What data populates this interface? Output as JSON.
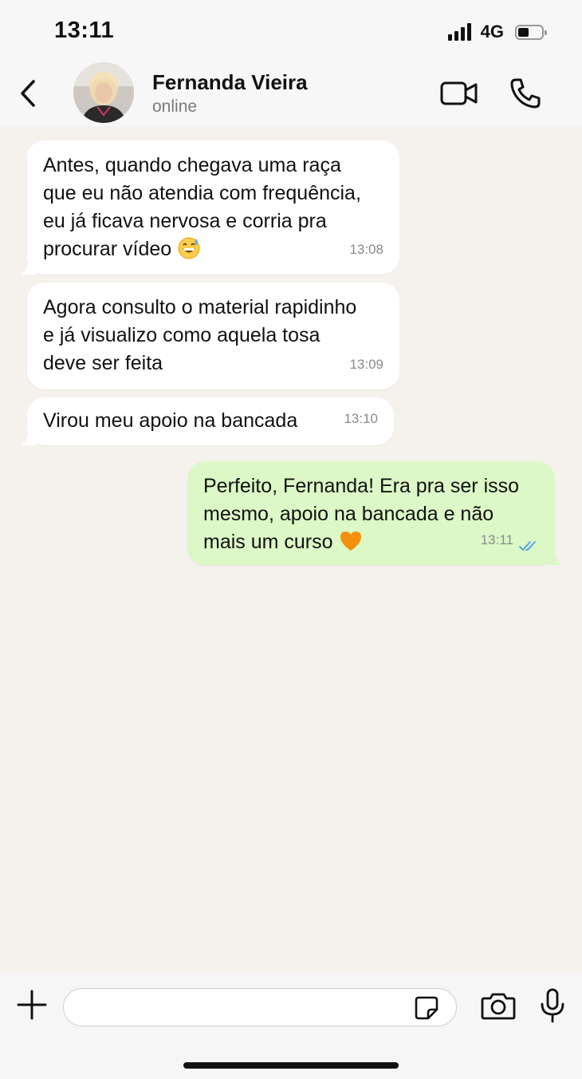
{
  "status_bar": {
    "time": "13:11",
    "network": "4G",
    "signal_bars": 4,
    "battery_level": 0.45
  },
  "header": {
    "contact_name": "Fernanda Vieira",
    "contact_status": "online",
    "back_icon": "chevron-left-icon",
    "video_icon": "video-camera-icon",
    "phone_icon": "phone-icon"
  },
  "messages": [
    {
      "direction": "incoming",
      "text": "Antes, quando chegava uma raça\nque eu não atendia com frequência,\neu já ficava nervosa e corria pra\nprocurar vídeo",
      "emoji": "grinning-sweat-face",
      "time": "13:08"
    },
    {
      "direction": "incoming",
      "text": "Agora consulto o material rapidinho\ne já visualizo como aquela tosa\ndeve ser feita",
      "time": "13:09"
    },
    {
      "direction": "incoming",
      "text": "Virou meu apoio na bancada",
      "time": "13:10"
    },
    {
      "direction": "outgoing",
      "text": "Perfeito, Fernanda! Era pra ser isso\nmesmo, apoio na bancada e não\nmais um curso",
      "emoji": "orange-heart",
      "time": "13:11",
      "read_status": "read-double-check"
    }
  ],
  "input_bar": {
    "placeholder": "",
    "icons": [
      "plus-icon",
      "sticker-icon",
      "camera-icon",
      "microphone-icon"
    ]
  },
  "colors": {
    "chat_background": "#f5f2ee",
    "incoming_bubble": "#ffffff",
    "outgoing_bubble": "#dcf8c6",
    "read_ticks": "#53a7e8"
  }
}
